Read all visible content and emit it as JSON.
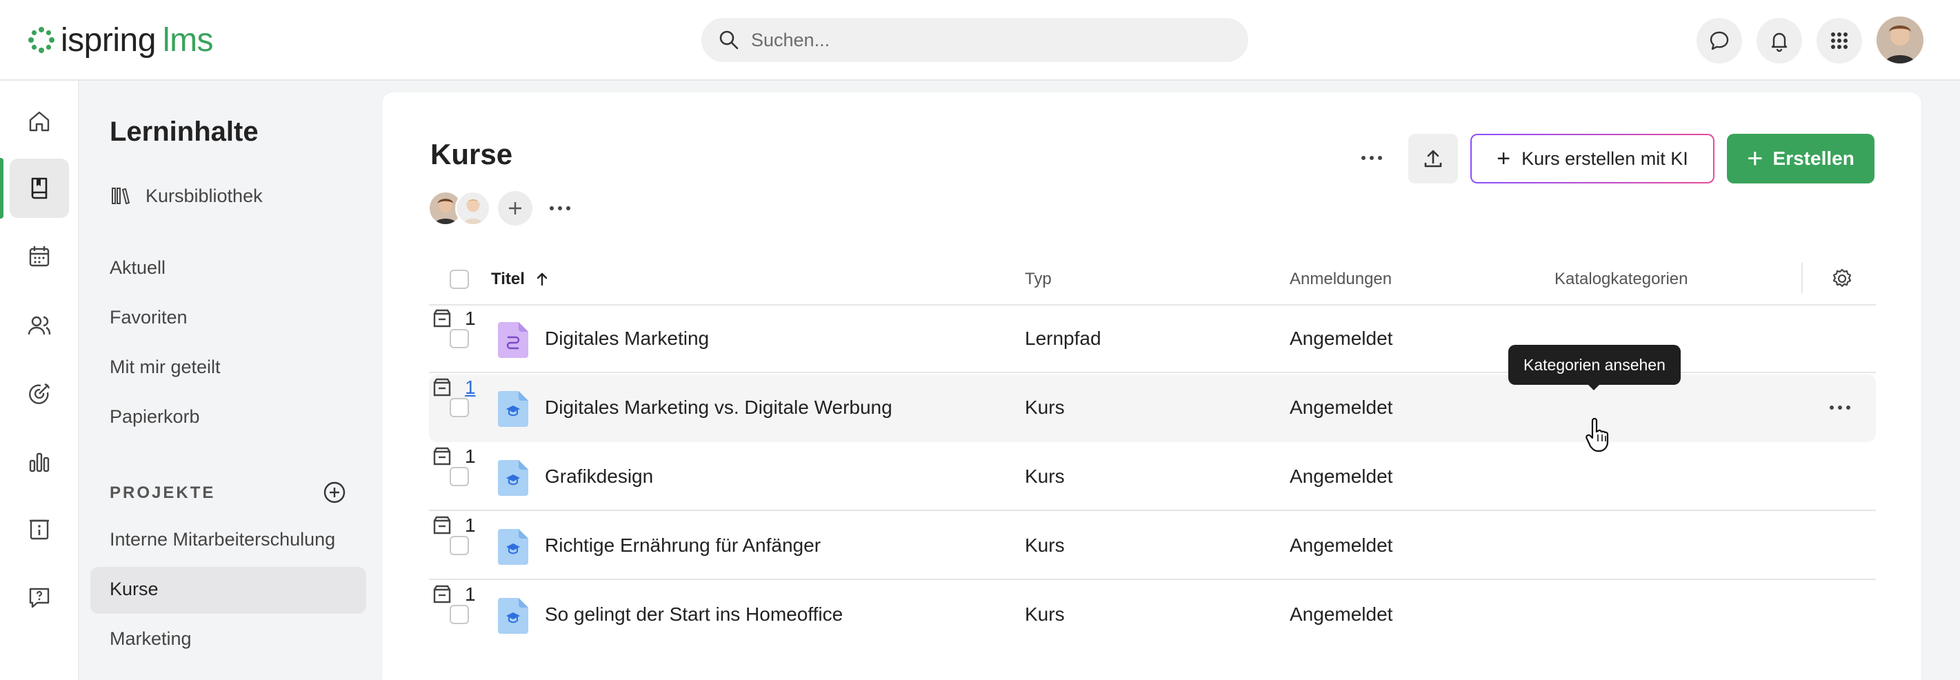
{
  "header": {
    "logo_text": "ispring",
    "logo_suffix": "lms",
    "search_placeholder": "Suchen..."
  },
  "colors": {
    "accent": "#3aa35b",
    "link": "#2f6fde",
    "ki_gradient_start": "#8b4dff",
    "ki_gradient_end": "#e64b9b"
  },
  "rail": {
    "items": [
      "home-icon",
      "book-icon",
      "calendar-icon",
      "users-icon",
      "target-icon",
      "chart-icon",
      "badge-icon",
      "help-chat-icon"
    ],
    "active": "book-icon"
  },
  "sidebar": {
    "title": "Lerninhalte",
    "library": "Kursbibliothek",
    "links": [
      "Aktuell",
      "Favoriten",
      "Mit mir geteilt",
      "Papierkorb"
    ],
    "projects_heading": "PROJEKTE",
    "projects": [
      "Interne Mitarbeiterschulung",
      "Kurse",
      "Marketing"
    ],
    "selected_project": "Kurse"
  },
  "main": {
    "title": "Kurse",
    "ki_button": "Kurs erstellen mit KI",
    "create_button": "Erstellen",
    "columns": {
      "title": "Titel",
      "type": "Typ",
      "enrollment": "Anmeldungen",
      "categories": "Katalogkategorien"
    },
    "rows": [
      {
        "title": "Digitales Marketing",
        "type": "Lernpfad",
        "enrollment": "Angemeldet",
        "categories": "1",
        "icon": "learning-path-icon"
      },
      {
        "title": "Digitales Marketing vs. Digitale Werbung",
        "type": "Kurs",
        "enrollment": "Angemeldet",
        "categories": "1",
        "icon": "course-icon"
      },
      {
        "title": "Grafikdesign",
        "type": "Kurs",
        "enrollment": "Angemeldet",
        "categories": "1",
        "icon": "course-icon"
      },
      {
        "title": "Richtige Ernährung für Anfänger",
        "type": "Kurs",
        "enrollment": "Angemeldet",
        "categories": "1",
        "icon": "course-icon"
      },
      {
        "title": "So gelingt der Start ins Homeoffice",
        "type": "Kurs",
        "enrollment": "Angemeldet",
        "categories": "1",
        "icon": "course-icon"
      }
    ],
    "tooltip": "Kategorien ansehen"
  }
}
